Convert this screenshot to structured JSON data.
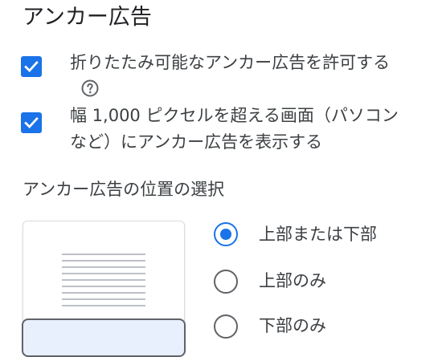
{
  "section": {
    "title": "アンカー広告"
  },
  "options": {
    "collapsible": {
      "checked": true,
      "label": "折りたたみ可能なアンカー広告を許可する",
      "help_icon": "help-circle-icon"
    },
    "desktop": {
      "checked": true,
      "label_line1": "幅 1,000 ピクセルを超える画面（パソコン",
      "label_line2": "など）にアンカー広告を表示する"
    }
  },
  "position": {
    "heading": "アンカー広告の位置の選択",
    "choices": [
      {
        "label": "上部または下部",
        "selected": true
      },
      {
        "label": "上部のみ",
        "selected": false
      },
      {
        "label": "下部のみ",
        "selected": false
      }
    ]
  },
  "colors": {
    "accent": "#1a73e8",
    "text": "#3c4043",
    "unselected_radio": "#5f6368"
  }
}
